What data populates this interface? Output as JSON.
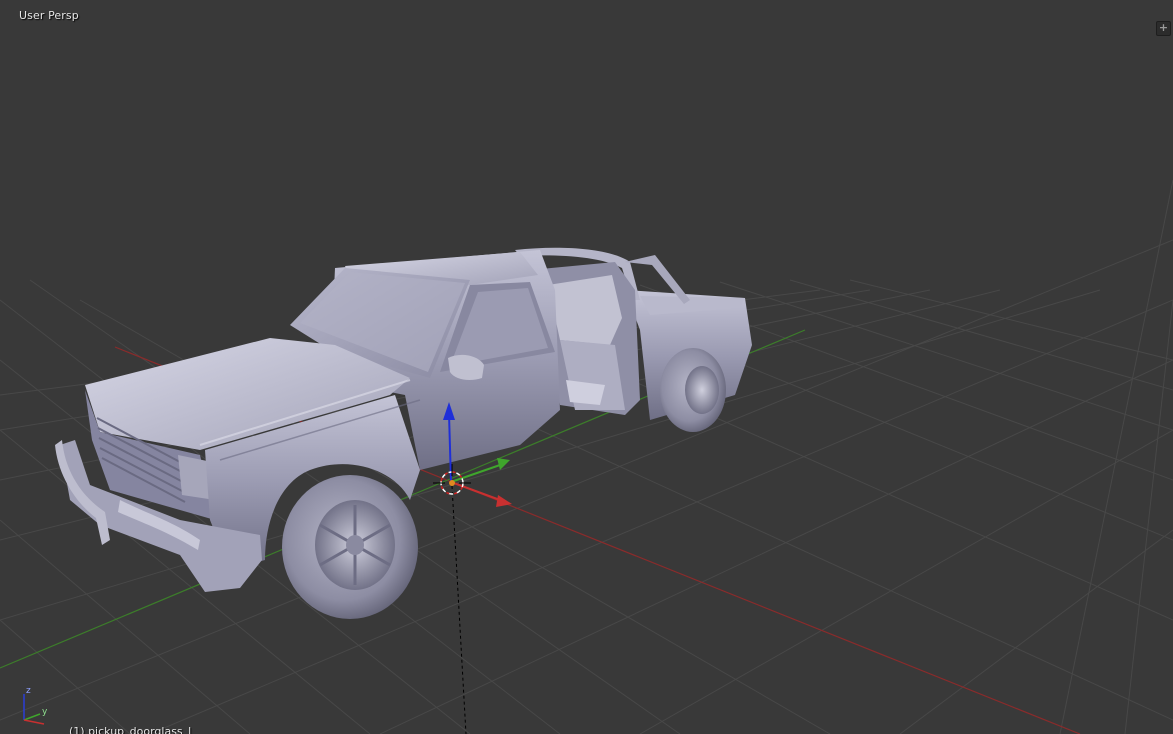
{
  "viewport": {
    "view_name": "User Persp",
    "active_object": "(1) pickup_doorglass_l",
    "fullscreen_toggle_symbol": "+"
  },
  "mini_axes": {
    "x": "x",
    "y": "y",
    "z": "z"
  },
  "colors": {
    "background": "#393939",
    "grid": "#4a4a4a",
    "x_axis": "#8f2a2a",
    "y_axis": "#3f8a2c",
    "z_axis": "#1f2fd8",
    "model": "#9c9cb2"
  },
  "icons": {
    "cursor": "3d-cursor-icon",
    "manipulator": "transform-manipulator-icon",
    "corner": "area-split-icon"
  }
}
